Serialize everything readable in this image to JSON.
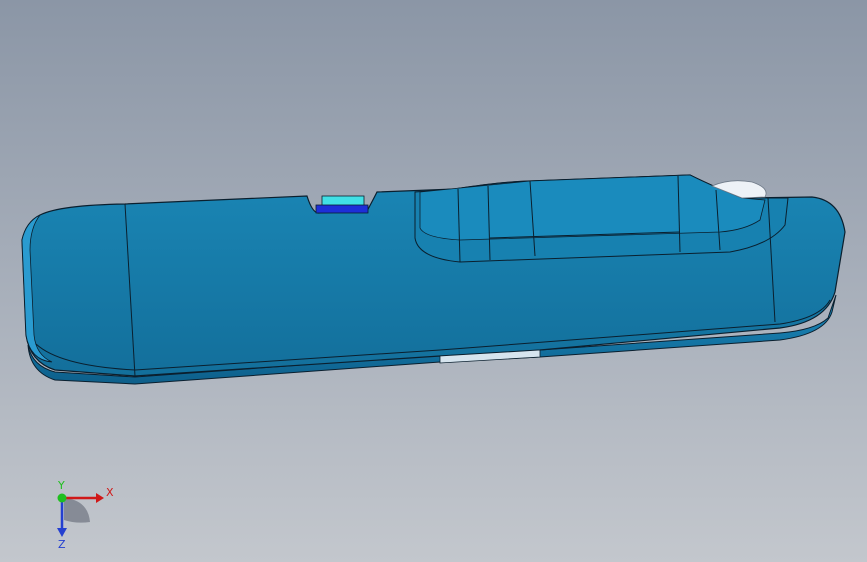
{
  "viewport": {
    "background_top": "#8b96a6",
    "background_bottom": "#c3c7cd"
  },
  "model": {
    "part_color": "#1578a6",
    "edge_color": "#0a1f2e",
    "insert_color": "#41e0e6",
    "insert_dark": "#1d2fd8"
  },
  "triad": {
    "x_label": "X",
    "y_label": "Y",
    "z_label": "Z",
    "x_color": "#d01818",
    "y_color": "#1fbf1f",
    "z_color": "#2440d0"
  }
}
